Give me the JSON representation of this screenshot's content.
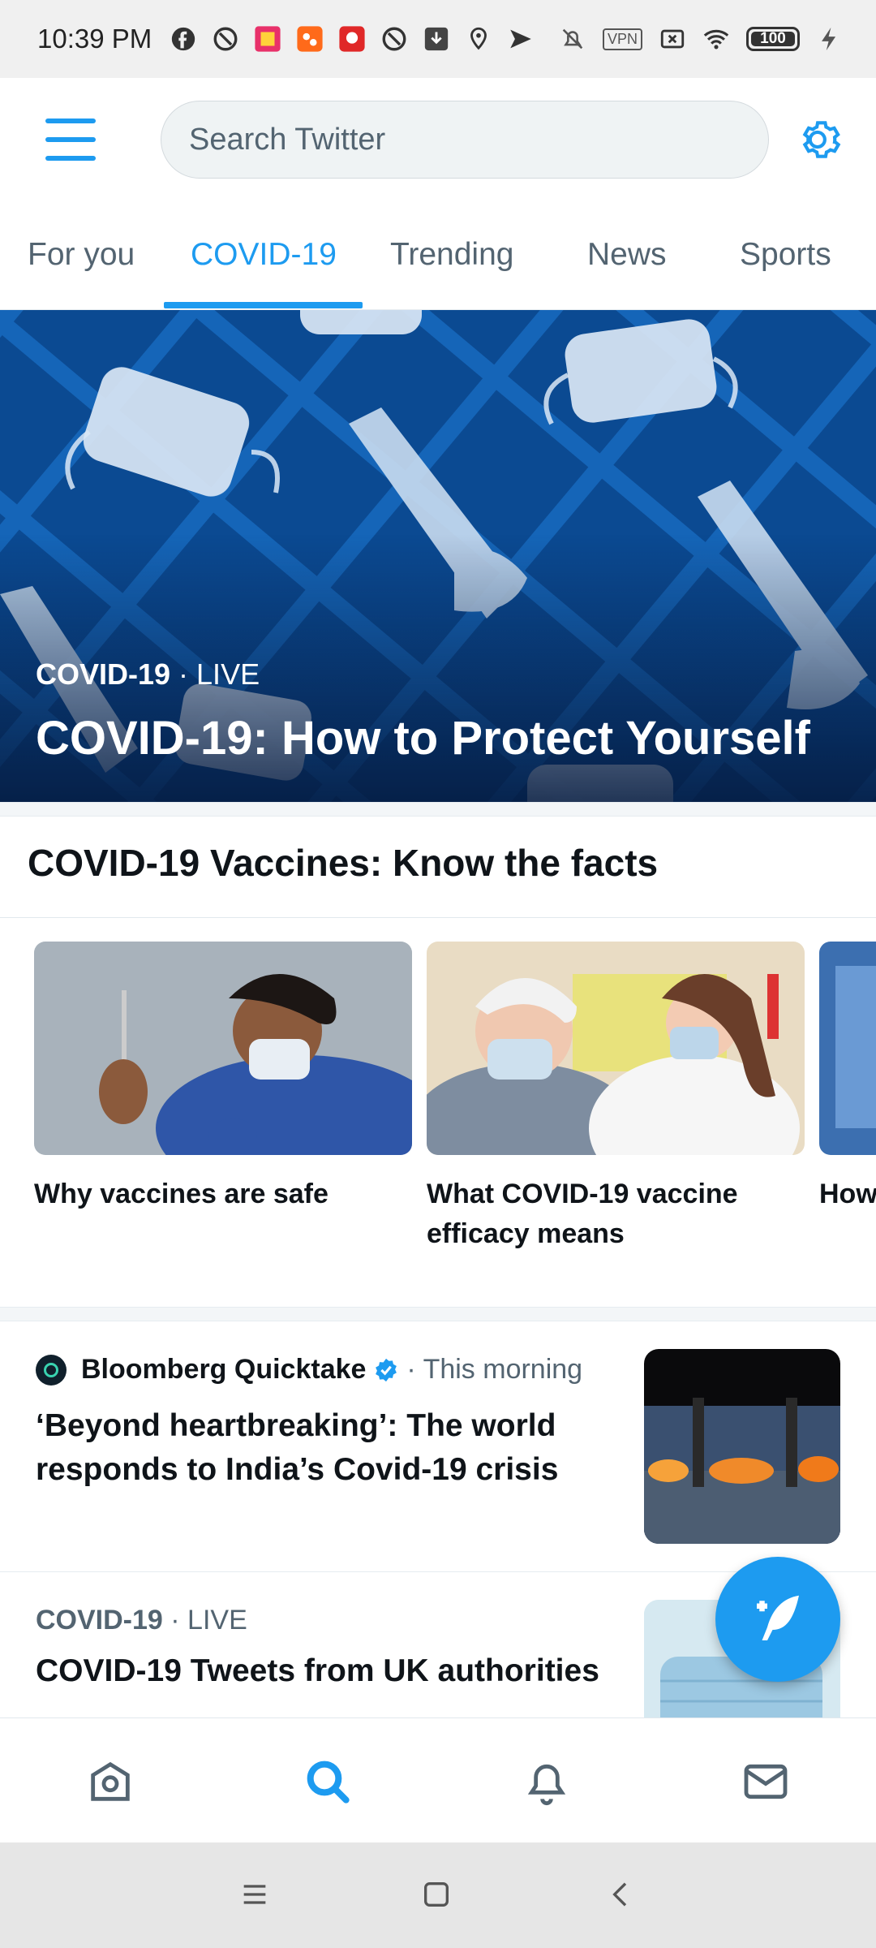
{
  "status_bar": {
    "time": "10:39 PM",
    "vpn_label": "VPN",
    "battery": "100",
    "icons": [
      "facebook-icon",
      "app-icon",
      "app-icon",
      "app-icon",
      "app-icon",
      "app-icon",
      "download-icon",
      "location-icon",
      "send-icon",
      "mute-icon",
      "vpn-icon",
      "sim-icon",
      "wifi-icon",
      "battery-icon",
      "charging-icon"
    ]
  },
  "header": {
    "search_placeholder": "Search Twitter"
  },
  "tabs": [
    {
      "label": "For you",
      "active": false
    },
    {
      "label": "COVID-19",
      "active": true
    },
    {
      "label": "Trending",
      "active": false
    },
    {
      "label": "News",
      "active": false
    },
    {
      "label": "Sports",
      "active": false
    }
  ],
  "hero": {
    "category": "COVID-19",
    "status": " · LIVE",
    "title": "COVID-19: How to Protect Yourself"
  },
  "section": {
    "title": "COVID-19 Vaccines: Know the facts"
  },
  "cards": [
    {
      "label": "Why vaccines are safe"
    },
    {
      "label": "What COVID-19 vaccine efficacy means"
    },
    {
      "label": "How work"
    }
  ],
  "news": {
    "author": "Bloomberg Quicktake",
    "time": "· This morning",
    "title": "‘Beyond heartbreaking’: The world responds to India’s Covid-19 crisis"
  },
  "live_item": {
    "category": "COVID-19",
    "status": " · LIVE",
    "title": "COVID-19 Tweets from UK authorities"
  },
  "colors": {
    "accent": "#1d9bf0",
    "text": "#0f1419",
    "muted": "#536471"
  }
}
